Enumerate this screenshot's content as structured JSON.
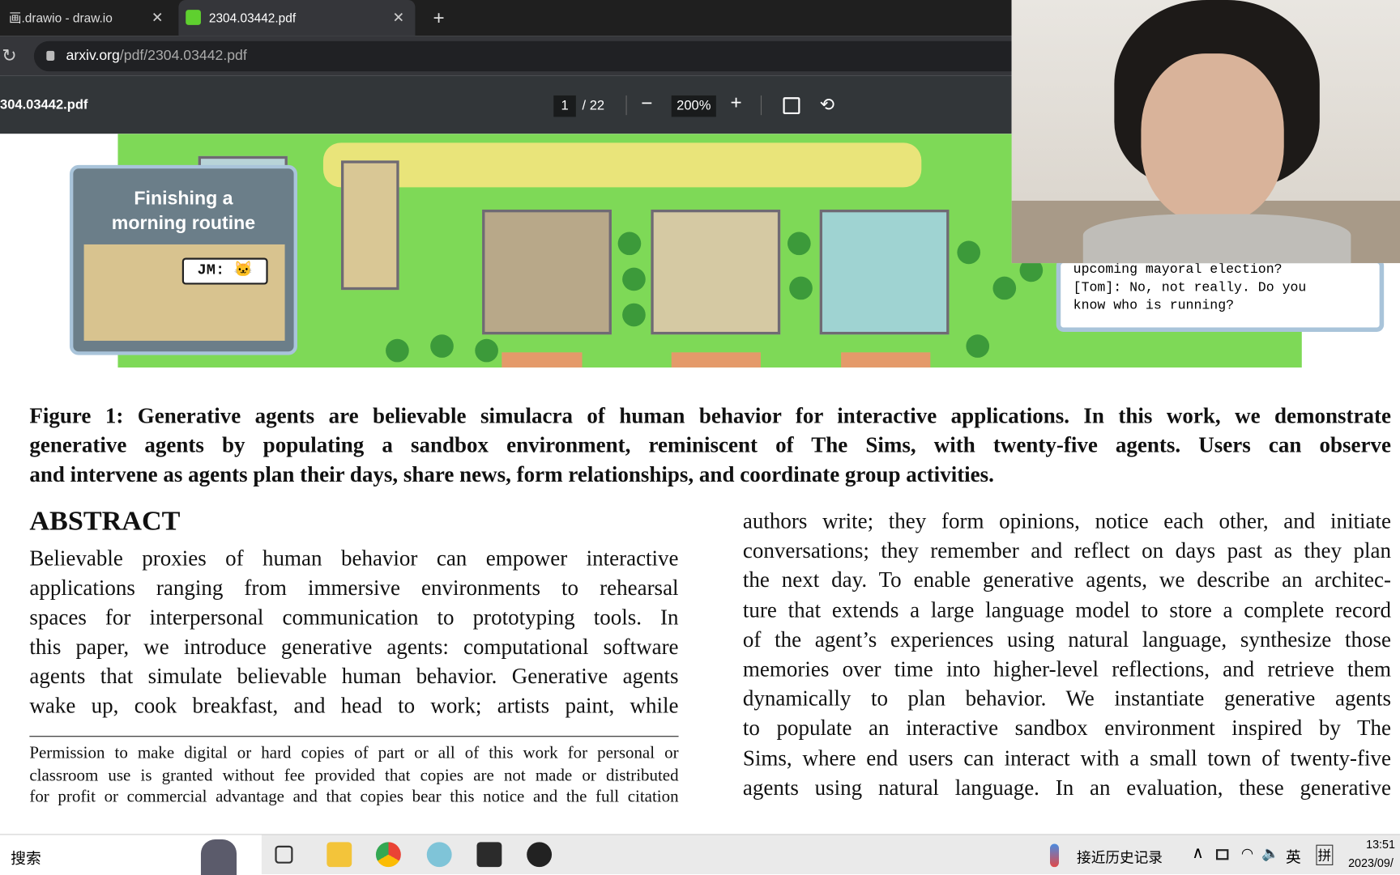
{
  "browser": {
    "tabs": [
      {
        "label": "画.drawio - draw.io",
        "active": false
      },
      {
        "label": "2304.03442.pdf",
        "active": true
      }
    ],
    "new_tab": "+",
    "close": "✕",
    "url_host": "arxiv.org",
    "url_path": "/pdf/2304.03442.pdf"
  },
  "pdf_toolbar": {
    "file_name": "304.03442.pdf",
    "page_current": "1",
    "page_total": "/ 22",
    "zoom": "200%",
    "zoom_out": "−",
    "zoom_in": "+"
  },
  "figure": {
    "inset_title": "Finishing a morning routine",
    "speech": "JM: 🐱",
    "dialogue": [
      "upcoming mayoral election?",
      "[Tom]: No, not really. Do you",
      "know who is running?"
    ]
  },
  "caption": [
    "Figure 1: Generative agents are believable simulacra of human behavior for interactive applications. In this work, we demonstrate",
    "generative agents by populating a sandbox environment, reminiscent of The Sims, with twenty-five agents. Users can observe",
    "and intervene as agents plan their days, share news, form relationships, and coordinate group activities."
  ],
  "abstract": {
    "heading": "ABSTRACT",
    "left_lines": [
      "Believable proxies of human behavior can empower interactive",
      "applications ranging from immersive environments to rehearsal",
      "spaces for interpersonal communication to prototyping tools. In",
      "this paper, we introduce generative agents: computational software",
      "agents that simulate believable human behavior. Generative agents",
      "wake up, cook breakfast, and head to work; artists paint, while"
    ],
    "footnote": [
      "Permission to make digital or hard copies of part or all of this work for personal or",
      "classroom use is granted without fee provided that copies are not made or distributed",
      "for profit or commercial advantage and that copies bear this notice and the full citation"
    ],
    "right_lines": [
      "authors write; they form opinions, notice each other, and initiate",
      "conversations; they remember and reflect on days past as they plan",
      "the next day. To enable generative agents, we describe an architec-",
      "ture that extends a large language model to store a complete record",
      "of the agent’s experiences using natural language, synthesize those",
      "memories over time into higher-level reflections, and retrieve them",
      "dynamically to plan behavior. We instantiate generative agents",
      "to populate an interactive sandbox environment inspired by The",
      "Sims, where end users can interact with a small town of twenty-five",
      "agents using natural language. In an evaluation, these generative"
    ]
  },
  "taskbar": {
    "search": "搜索",
    "weather": "接近历史记录",
    "ime_lang": "英",
    "ime_mode": "拼",
    "time": "13:51",
    "date": "2023/09/"
  },
  "colors": {
    "tabbar": "#1f1f1f",
    "toolbar": "#323639",
    "taskbar": "#eaeaea",
    "map_green": "#7ed957"
  }
}
